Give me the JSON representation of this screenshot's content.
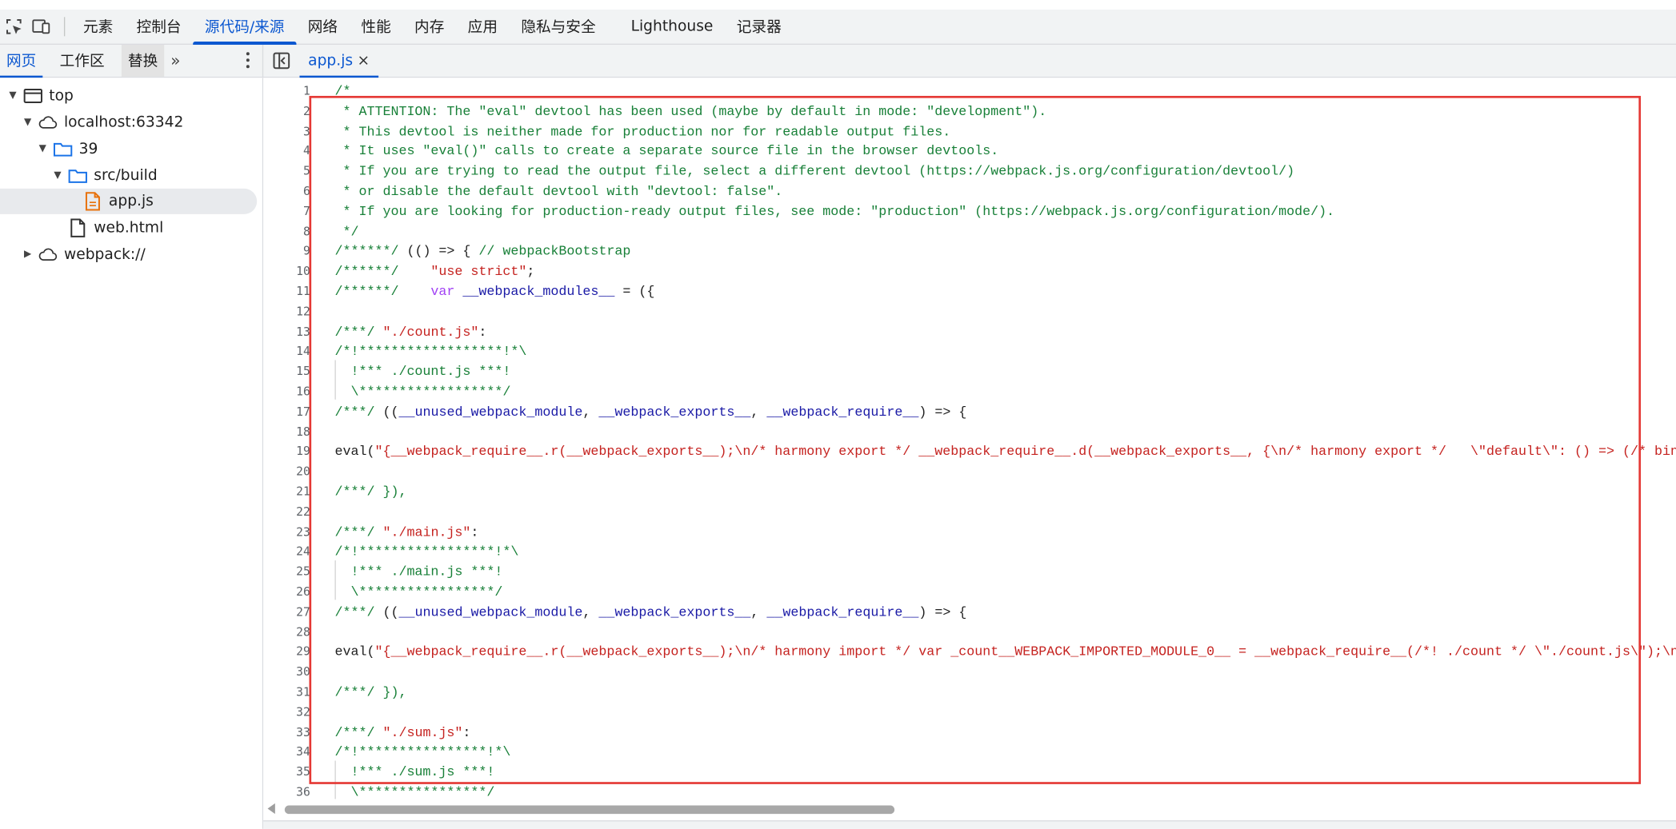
{
  "toolbar": {
    "tabs": [
      {
        "label": "元素"
      },
      {
        "label": "控制台"
      },
      {
        "label": "源代码/来源"
      },
      {
        "label": "网络"
      },
      {
        "label": "性能"
      },
      {
        "label": "内存"
      },
      {
        "label": "应用"
      },
      {
        "label": "隐私与安全"
      },
      {
        "label": "Lighthouse"
      },
      {
        "label": "记录器"
      }
    ],
    "active_tab": "源代码/来源"
  },
  "navigator": {
    "tabs": [
      {
        "label": "网页"
      },
      {
        "label": "工作区"
      },
      {
        "label": "替换"
      }
    ],
    "more": "»"
  },
  "editor_tab": {
    "label": "app.js",
    "close": "×"
  },
  "tree": [
    {
      "label": "top",
      "icon": "window-icon",
      "expanded": true
    },
    {
      "label": "localhost:63342",
      "icon": "cloud-icon",
      "expanded": true
    },
    {
      "label": "39",
      "icon": "folder-icon",
      "expanded": true
    },
    {
      "label": "src/build",
      "icon": "folder-icon",
      "expanded": true
    },
    {
      "label": "app.js",
      "icon": "js-file-icon",
      "selected": true
    },
    {
      "label": "web.html",
      "icon": "file-icon"
    },
    {
      "label": "webpack://",
      "icon": "cloud-icon",
      "expanded": false
    }
  ],
  "code": {
    "line_numbers": [
      "1",
      "2",
      "3",
      "4",
      "5",
      "6",
      "7",
      "8",
      "9",
      "10",
      "11",
      "12",
      "13",
      "14",
      "15",
      "16",
      "17",
      "18",
      "19",
      "20",
      "21",
      "22",
      "23",
      "24",
      "25",
      "26",
      "27",
      "28",
      "29",
      "30",
      "31",
      "32",
      "33",
      "34",
      "35",
      "36"
    ],
    "lines": [
      {
        "t": "/*",
        "cls": "comment"
      },
      {
        "t": " * ATTENTION: The \"eval\" devtool has been used (maybe by default in mode: \"development\").",
        "cls": "comment"
      },
      {
        "t": " * This devtool is neither made for production nor for readable output files.",
        "cls": "comment"
      },
      {
        "t": " * It uses \"eval()\" calls to create a separate source file in the browser devtools.",
        "cls": "comment"
      },
      {
        "t": " * If you are trying to read the output file, select a different devtool (https://webpack.js.org/configuration/devtool/)",
        "cls": "comment"
      },
      {
        "t": " * or disable the default devtool with \"devtool: false\".",
        "cls": "comment"
      },
      {
        "t": " * If you are looking for production-ready output files, see mode: \"production\" (https://webpack.js.org/configuration/mode/).",
        "cls": "comment"
      },
      {
        "t": " */",
        "cls": "comment"
      },
      {
        "t": "",
        "cls": "mixed",
        "parts": [
          [
            "c",
            "/******/ "
          ],
          [
            "p",
            "(() => { "
          ],
          [
            "c",
            "// webpackBootstrap"
          ]
        ]
      },
      {
        "t": "",
        "cls": "mixed",
        "parts": [
          [
            "c",
            "/******/ \t"
          ],
          [
            "s",
            "\"use strict\""
          ],
          [
            "p",
            ";"
          ]
        ]
      },
      {
        "t": "",
        "cls": "mixed",
        "parts": [
          [
            "c",
            "/******/ \t"
          ],
          [
            "k",
            "var "
          ],
          [
            "v",
            "__webpack_modules__"
          ],
          [
            "p",
            " = ({"
          ]
        ]
      },
      {
        "t": "",
        "cls": ""
      },
      {
        "t": "",
        "cls": "mixed",
        "parts": [
          [
            "c",
            "/***/ "
          ],
          [
            "s",
            "\"./count.js\""
          ],
          [
            "p",
            ":"
          ]
        ]
      },
      {
        "t": "/*!******************!*\\",
        "cls": "comment"
      },
      {
        "t": "  !*** ./count.js ***!",
        "cls": "comment"
      },
      {
        "t": "  \\******************/",
        "cls": "comment"
      },
      {
        "t": "",
        "cls": "mixed",
        "parts": [
          [
            "c",
            "/***/ "
          ],
          [
            "p",
            "(("
          ],
          [
            "v",
            "__unused_webpack_module"
          ],
          [
            "p",
            ", "
          ],
          [
            "v",
            "__webpack_exports__"
          ],
          [
            "p",
            ", "
          ],
          [
            "v",
            "__webpack_require__"
          ],
          [
            "p",
            ") => {"
          ]
        ]
      },
      {
        "t": "",
        "cls": ""
      },
      {
        "t": "",
        "cls": "mixed",
        "parts": [
          [
            "p",
            "eval("
          ],
          [
            "s",
            "\"{__webpack_require__.r(__webpack_exports__);\\n/* harmony export */ __webpack_require__.d(__webpack_exports__, {\\n/* harmony export */   \\\"default\\\": () => (/* binding */ count)\\n/* harmony export */ });\\n"
          ]
        ]
      },
      {
        "t": "",
        "cls": ""
      },
      {
        "t": "/***/ }),",
        "cls": "comment"
      },
      {
        "t": "",
        "cls": ""
      },
      {
        "t": "",
        "cls": "mixed",
        "parts": [
          [
            "c",
            "/***/ "
          ],
          [
            "s",
            "\"./main.js\""
          ],
          [
            "p",
            ":"
          ]
        ]
      },
      {
        "t": "/*!*****************!*\\",
        "cls": "comment"
      },
      {
        "t": "  !*** ./main.js ***!",
        "cls": "comment"
      },
      {
        "t": "  \\*****************/",
        "cls": "comment"
      },
      {
        "t": "",
        "cls": "mixed",
        "parts": [
          [
            "c",
            "/***/ "
          ],
          [
            "p",
            "(("
          ],
          [
            "v",
            "__unused_webpack_module"
          ],
          [
            "p",
            ", "
          ],
          [
            "v",
            "__webpack_exports__"
          ],
          [
            "p",
            ", "
          ],
          [
            "v",
            "__webpack_require__"
          ],
          [
            "p",
            ") => {"
          ]
        ]
      },
      {
        "t": "",
        "cls": ""
      },
      {
        "t": "",
        "cls": "mixed",
        "parts": [
          [
            "p",
            "eval("
          ],
          [
            "s",
            "\"{__webpack_require__.r(__webpack_exports__);\\n/* harmony import */ var _count__WEBPACK_IMPORTED_MODULE_0__ = __webpack_require__(/*! ./count */ \\\"./count.js\\\");\\n/* harmony import */ "
          ]
        ]
      },
      {
        "t": "",
        "cls": ""
      },
      {
        "t": "/***/ }),",
        "cls": "comment"
      },
      {
        "t": "",
        "cls": ""
      },
      {
        "t": "",
        "cls": "mixed",
        "parts": [
          [
            "c",
            "/***/ "
          ],
          [
            "s",
            "\"./sum.js\""
          ],
          [
            "p",
            ":"
          ]
        ]
      },
      {
        "t": "/*!****************!*\\",
        "cls": "comment"
      },
      {
        "t": "  !*** ./sum.js ***!",
        "cls": "comment"
      },
      {
        "t": "  \\****************/",
        "cls": "comment"
      }
    ]
  },
  "colors": {
    "accent": "#0b57d0",
    "comment": "#188038",
    "string": "#c5221f",
    "keyword": "#a142f4",
    "variable": "#1a1aa6",
    "highlight_box": "#e53935"
  }
}
